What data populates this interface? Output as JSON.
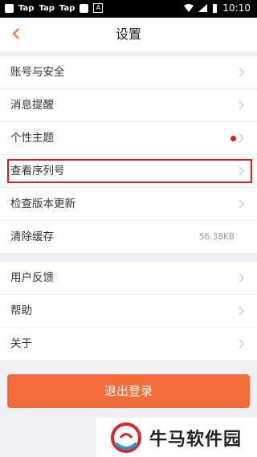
{
  "status_bar": {
    "apps": [
      "Tap",
      "Tap",
      "Tap"
    ],
    "time": "10:10"
  },
  "nav": {
    "back_icon": "chevron-left-icon",
    "title": "设置"
  },
  "settings_group_1": [
    {
      "label": "账号与安全"
    },
    {
      "label": "消息提醒"
    },
    {
      "label": "个性主题",
      "badge": "red-dot"
    },
    {
      "label": "查看序列号"
    },
    {
      "label": "检查版本更新"
    },
    {
      "label": "清除缓存",
      "value": "56.38KB"
    }
  ],
  "settings_group_2": [
    {
      "label": "用户反馈"
    },
    {
      "label": "帮助"
    },
    {
      "label": "关于"
    }
  ],
  "logout": {
    "label": "退出登录"
  },
  "watermark": {
    "text": "牛马软件园"
  },
  "colors": {
    "accent": "#f36d3b",
    "highlight_border": "#d81e1e",
    "badge": "#e21b1b"
  }
}
